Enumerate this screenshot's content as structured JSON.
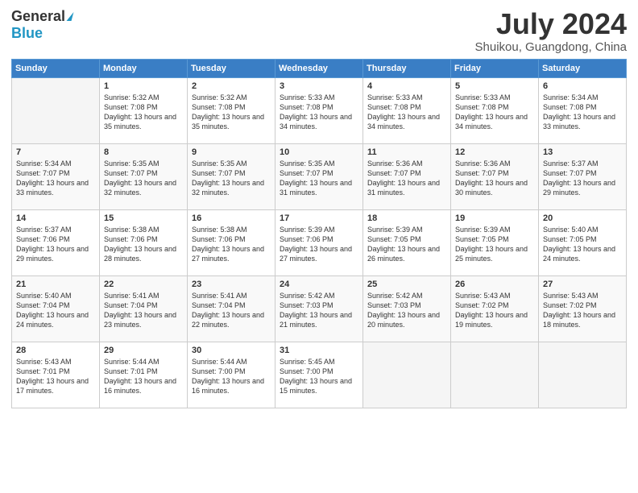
{
  "header": {
    "logo_general": "General",
    "logo_blue": "Blue",
    "month_year": "July 2024",
    "location": "Shuikou, Guangdong, China"
  },
  "days_of_week": [
    "Sunday",
    "Monday",
    "Tuesday",
    "Wednesday",
    "Thursday",
    "Friday",
    "Saturday"
  ],
  "weeks": [
    [
      {
        "day": "",
        "sunrise": "",
        "sunset": "",
        "daylight": ""
      },
      {
        "day": "1",
        "sunrise": "Sunrise: 5:32 AM",
        "sunset": "Sunset: 7:08 PM",
        "daylight": "Daylight: 13 hours and 35 minutes."
      },
      {
        "day": "2",
        "sunrise": "Sunrise: 5:32 AM",
        "sunset": "Sunset: 7:08 PM",
        "daylight": "Daylight: 13 hours and 35 minutes."
      },
      {
        "day": "3",
        "sunrise": "Sunrise: 5:33 AM",
        "sunset": "Sunset: 7:08 PM",
        "daylight": "Daylight: 13 hours and 34 minutes."
      },
      {
        "day": "4",
        "sunrise": "Sunrise: 5:33 AM",
        "sunset": "Sunset: 7:08 PM",
        "daylight": "Daylight: 13 hours and 34 minutes."
      },
      {
        "day": "5",
        "sunrise": "Sunrise: 5:33 AM",
        "sunset": "Sunset: 7:08 PM",
        "daylight": "Daylight: 13 hours and 34 minutes."
      },
      {
        "day": "6",
        "sunrise": "Sunrise: 5:34 AM",
        "sunset": "Sunset: 7:08 PM",
        "daylight": "Daylight: 13 hours and 33 minutes."
      }
    ],
    [
      {
        "day": "7",
        "sunrise": "Sunrise: 5:34 AM",
        "sunset": "Sunset: 7:07 PM",
        "daylight": "Daylight: 13 hours and 33 minutes."
      },
      {
        "day": "8",
        "sunrise": "Sunrise: 5:35 AM",
        "sunset": "Sunset: 7:07 PM",
        "daylight": "Daylight: 13 hours and 32 minutes."
      },
      {
        "day": "9",
        "sunrise": "Sunrise: 5:35 AM",
        "sunset": "Sunset: 7:07 PM",
        "daylight": "Daylight: 13 hours and 32 minutes."
      },
      {
        "day": "10",
        "sunrise": "Sunrise: 5:35 AM",
        "sunset": "Sunset: 7:07 PM",
        "daylight": "Daylight: 13 hours and 31 minutes."
      },
      {
        "day": "11",
        "sunrise": "Sunrise: 5:36 AM",
        "sunset": "Sunset: 7:07 PM",
        "daylight": "Daylight: 13 hours and 31 minutes."
      },
      {
        "day": "12",
        "sunrise": "Sunrise: 5:36 AM",
        "sunset": "Sunset: 7:07 PM",
        "daylight": "Daylight: 13 hours and 30 minutes."
      },
      {
        "day": "13",
        "sunrise": "Sunrise: 5:37 AM",
        "sunset": "Sunset: 7:07 PM",
        "daylight": "Daylight: 13 hours and 29 minutes."
      }
    ],
    [
      {
        "day": "14",
        "sunrise": "Sunrise: 5:37 AM",
        "sunset": "Sunset: 7:06 PM",
        "daylight": "Daylight: 13 hours and 29 minutes."
      },
      {
        "day": "15",
        "sunrise": "Sunrise: 5:38 AM",
        "sunset": "Sunset: 7:06 PM",
        "daylight": "Daylight: 13 hours and 28 minutes."
      },
      {
        "day": "16",
        "sunrise": "Sunrise: 5:38 AM",
        "sunset": "Sunset: 7:06 PM",
        "daylight": "Daylight: 13 hours and 27 minutes."
      },
      {
        "day": "17",
        "sunrise": "Sunrise: 5:39 AM",
        "sunset": "Sunset: 7:06 PM",
        "daylight": "Daylight: 13 hours and 27 minutes."
      },
      {
        "day": "18",
        "sunrise": "Sunrise: 5:39 AM",
        "sunset": "Sunset: 7:05 PM",
        "daylight": "Daylight: 13 hours and 26 minutes."
      },
      {
        "day": "19",
        "sunrise": "Sunrise: 5:39 AM",
        "sunset": "Sunset: 7:05 PM",
        "daylight": "Daylight: 13 hours and 25 minutes."
      },
      {
        "day": "20",
        "sunrise": "Sunrise: 5:40 AM",
        "sunset": "Sunset: 7:05 PM",
        "daylight": "Daylight: 13 hours and 24 minutes."
      }
    ],
    [
      {
        "day": "21",
        "sunrise": "Sunrise: 5:40 AM",
        "sunset": "Sunset: 7:04 PM",
        "daylight": "Daylight: 13 hours and 24 minutes."
      },
      {
        "day": "22",
        "sunrise": "Sunrise: 5:41 AM",
        "sunset": "Sunset: 7:04 PM",
        "daylight": "Daylight: 13 hours and 23 minutes."
      },
      {
        "day": "23",
        "sunrise": "Sunrise: 5:41 AM",
        "sunset": "Sunset: 7:04 PM",
        "daylight": "Daylight: 13 hours and 22 minutes."
      },
      {
        "day": "24",
        "sunrise": "Sunrise: 5:42 AM",
        "sunset": "Sunset: 7:03 PM",
        "daylight": "Daylight: 13 hours and 21 minutes."
      },
      {
        "day": "25",
        "sunrise": "Sunrise: 5:42 AM",
        "sunset": "Sunset: 7:03 PM",
        "daylight": "Daylight: 13 hours and 20 minutes."
      },
      {
        "day": "26",
        "sunrise": "Sunrise: 5:43 AM",
        "sunset": "Sunset: 7:02 PM",
        "daylight": "Daylight: 13 hours and 19 minutes."
      },
      {
        "day": "27",
        "sunrise": "Sunrise: 5:43 AM",
        "sunset": "Sunset: 7:02 PM",
        "daylight": "Daylight: 13 hours and 18 minutes."
      }
    ],
    [
      {
        "day": "28",
        "sunrise": "Sunrise: 5:43 AM",
        "sunset": "Sunset: 7:01 PM",
        "daylight": "Daylight: 13 hours and 17 minutes."
      },
      {
        "day": "29",
        "sunrise": "Sunrise: 5:44 AM",
        "sunset": "Sunset: 7:01 PM",
        "daylight": "Daylight: 13 hours and 16 minutes."
      },
      {
        "day": "30",
        "sunrise": "Sunrise: 5:44 AM",
        "sunset": "Sunset: 7:00 PM",
        "daylight": "Daylight: 13 hours and 16 minutes."
      },
      {
        "day": "31",
        "sunrise": "Sunrise: 5:45 AM",
        "sunset": "Sunset: 7:00 PM",
        "daylight": "Daylight: 13 hours and 15 minutes."
      },
      {
        "day": "",
        "sunrise": "",
        "sunset": "",
        "daylight": ""
      },
      {
        "day": "",
        "sunrise": "",
        "sunset": "",
        "daylight": ""
      },
      {
        "day": "",
        "sunrise": "",
        "sunset": "",
        "daylight": ""
      }
    ]
  ]
}
